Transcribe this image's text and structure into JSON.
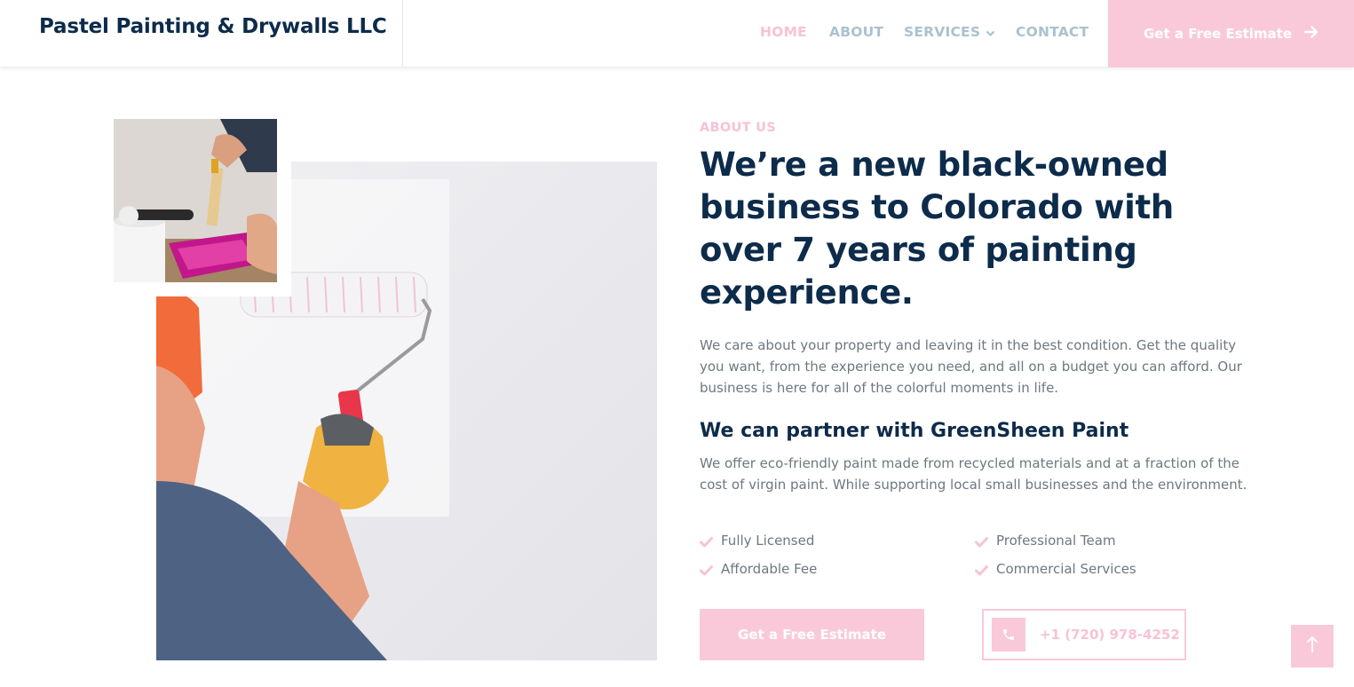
{
  "header": {
    "brand": "Pastel Painting & Drywalls LLC",
    "nav": [
      {
        "label": "HOME",
        "active": true
      },
      {
        "label": "ABOUT",
        "active": false
      },
      {
        "label": "SERVICES",
        "active": false,
        "has_dropdown": true
      },
      {
        "label": "CONTACT",
        "active": false
      }
    ],
    "cta_label": "Get a Free Estimate",
    "cta_icon": "arrow-right-icon"
  },
  "about": {
    "eyebrow": "ABOUT US",
    "headline": "We’re a new black-owned business to Colorado with over 7 years of painting experience.",
    "paragraph": "We care about your property and leaving it in the best condition. Get the quality you want, from the experience you need, and all on a budget you can afford. Our business is here for all of the colorful moments in life.",
    "subheading": "We can partner with GreenSheen Paint",
    "paragraph2": "We offer eco-friendly paint made from recycled materials and at a fraction of the cost of virgin paint. While supporting local small businesses and the environment.",
    "features": [
      "Fully Licensed",
      "Professional Team",
      "Affordable Fee",
      "Commercial Services"
    ],
    "cta_label": "Get a Free Estimate",
    "phone": "+1 (720) 978-4252",
    "phone_icon": "phone-icon"
  },
  "colors": {
    "accent_pink": "#f9c9da",
    "navy": "#0d2b4a",
    "nav_gray": "#a9c2cf",
    "body_text": "#6e7780"
  },
  "scroll_top_icon": "arrow-up-icon"
}
